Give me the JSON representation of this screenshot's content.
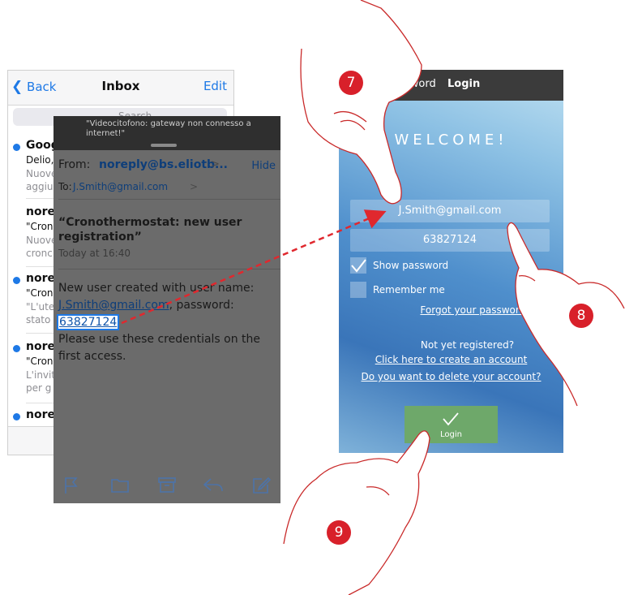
{
  "inbox": {
    "back": "Back",
    "title": "Inbox",
    "edit": "Edit",
    "search_placeholder": "Search",
    "items": [
      {
        "sender": "Goog",
        "subject": "Delio,",
        "preview": "Nuove\naggiu"
      },
      {
        "sender": "nore",
        "subject": "\"Cron",
        "preview": "Nuove\ncronc"
      },
      {
        "sender": "nore",
        "subject": "\"Cron",
        "preview": "\"L'ute\nstato"
      },
      {
        "sender": "nore",
        "subject": "\"Cron",
        "preview": "L'invit\nper g"
      },
      {
        "sender": "nore",
        "subject": "",
        "preview": ""
      }
    ]
  },
  "mail": {
    "notification": "\"Videocitofono: gateway non connesso a internet!\"",
    "from_label": "From:",
    "from_address": "noreply@bs.eliotb...",
    "hide": "Hide",
    "to_label": "To:",
    "to_address": "J.Smith@gmail.com",
    "subject": "“Cronothermostat: new user registration”",
    "date": "Today at 16:40",
    "body_intro": "New user created with user name:",
    "body_username": "J.Smith@gmail.com",
    "body_pwd_label": ", password:",
    "body_password": "63827124",
    "body_outro": "Please use these credentials on the first access."
  },
  "login": {
    "reset": "eset password",
    "title": "Login",
    "welcome": "WELCOME!",
    "email": "J.Smith@gmail.com",
    "password": "63827124",
    "show_password": "Show password",
    "remember_me": "Remember me",
    "forgot": "Forgot your password?",
    "not_registered": "Not yet registered?",
    "create": "Click here to create an account",
    "delete": "Do you want to delete your account?",
    "login_button": "Login"
  },
  "badges": {
    "b7": "7",
    "b8": "8",
    "b9": "9"
  },
  "colors": {
    "accent": "#1e79e6",
    "badge": "#d8202a",
    "arrow": "#e0282e",
    "login_button": "#6ea86a"
  }
}
